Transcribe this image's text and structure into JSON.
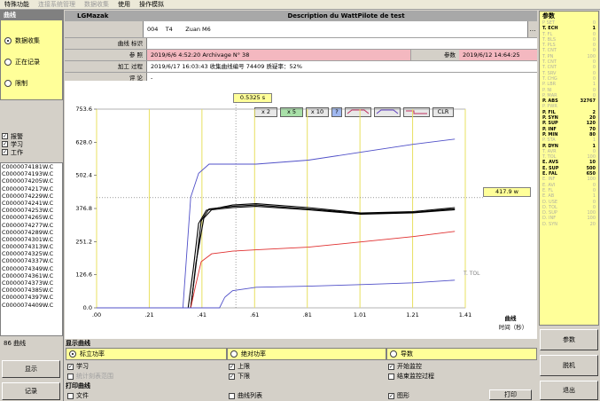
{
  "menu": {
    "items": [
      {
        "label": "特殊功能",
        "dim": false
      },
      {
        "label": "连接系统管理",
        "dim": true
      },
      {
        "label": "数据收集",
        "dim": true
      },
      {
        "label": "使用",
        "dim": false
      },
      {
        "label": "操作模拟",
        "dim": false
      }
    ]
  },
  "left": {
    "header": "曲线",
    "radios": [
      {
        "label": "数据收集",
        "selected": true
      },
      {
        "label": "正在记录",
        "selected": false
      },
      {
        "label": "限制",
        "selected": false
      }
    ],
    "checks": [
      {
        "label": "报警",
        "checked": true
      },
      {
        "label": "学习",
        "checked": true
      },
      {
        "label": "工作",
        "checked": true
      }
    ],
    "files": [
      "C0000074181W.C",
      "C0000074193W.C",
      "C0000074205W.C",
      "C0000074217W.C",
      "C0000074229W.C",
      "C0000074241W.C",
      "C0000074253W.C",
      "C0000074265W.C",
      "C0000074277W.C",
      "C0000074289W.C",
      "C0000074301W.C",
      "C0000074313W.C",
      "C0000074325W.C",
      "C0000074337W.C",
      "C0000074349W.C",
      "C0000074361W.C",
      "C0000074373W.C",
      "C0000074385W.C",
      "C0000074397W.C",
      "C0000074409W.C"
    ],
    "count_label": "86 曲线",
    "btn_display": "显示",
    "btn_record": "记录"
  },
  "header": {
    "app_name": "LGMazak",
    "title": "Description du WattPilote de test",
    "line1_a": "004",
    "line1_b": "T4",
    "line1_c": "Zuan M6",
    "row_curve_label": "曲线 标识",
    "row_ref_label": "参 照",
    "row_ref_value": "2019/6/6 4:52:20 Archivage N° 38",
    "row_param_label": "参数",
    "row_param_value": "2019/6/12 14:64:25",
    "row_proc_label": "加工 过程",
    "row_proc_value": "2019/6/17 16:03:43 收集曲线编号 74409 质疑率：52%",
    "row_comment_label": "评 论",
    "row_comment_value": "-"
  },
  "toolbar": {
    "cursor_readout": "0.5325 s",
    "zoom_labels": [
      "x 2",
      "x 5",
      "x 10"
    ],
    "help": "?",
    "clr": "CLR",
    "right_readout": "417.9 w"
  },
  "chart_data": {
    "type": "line",
    "xlabel": "时间（秒）",
    "ylabel": "",
    "x_unit_label": "曲线",
    "xlim": [
      0.0,
      1.41
    ],
    "ylim": [
      0.0,
      753.6
    ],
    "x_ticks": [
      ".00",
      ".21",
      ".41",
      ".61",
      ".81",
      "1.01",
      "1.21",
      "1.41"
    ],
    "y_ticks": [
      "0.0",
      "126.6",
      "251.2",
      "376.8",
      "502.4",
      "628.0",
      "753.6"
    ],
    "threshold_label": "T. TOL",
    "threshold_y": 417.9,
    "cursor_x": 0.5325,
    "series": [
      {
        "color": "#5050c8",
        "points": [
          [
            0.0,
            0
          ],
          [
            0.33,
            0
          ],
          [
            0.36,
            420
          ],
          [
            0.39,
            510
          ],
          [
            0.43,
            545
          ],
          [
            0.52,
            545
          ],
          [
            0.61,
            545
          ],
          [
            0.81,
            560
          ],
          [
            1.01,
            590
          ],
          [
            1.21,
            620
          ],
          [
            1.37,
            640
          ]
        ]
      },
      {
        "color": "#000000",
        "points": [
          [
            0.0,
            0
          ],
          [
            0.35,
            0
          ],
          [
            0.37,
            150
          ],
          [
            0.39,
            320
          ],
          [
            0.42,
            370
          ],
          [
            0.52,
            390
          ],
          [
            0.61,
            395
          ],
          [
            0.81,
            380
          ],
          [
            1.01,
            360
          ],
          [
            1.21,
            365
          ],
          [
            1.37,
            380
          ]
        ]
      },
      {
        "color": "#000000",
        "points": [
          [
            0.0,
            0
          ],
          [
            0.36,
            0
          ],
          [
            0.38,
            160
          ],
          [
            0.4,
            330
          ],
          [
            0.43,
            375
          ],
          [
            0.52,
            385
          ],
          [
            0.61,
            390
          ],
          [
            0.81,
            375
          ],
          [
            1.01,
            358
          ],
          [
            1.21,
            362
          ],
          [
            1.37,
            375
          ]
        ]
      },
      {
        "color": "#000000",
        "points": [
          [
            0.0,
            0
          ],
          [
            0.36,
            0
          ],
          [
            0.38,
            170
          ],
          [
            0.41,
            340
          ],
          [
            0.44,
            372
          ],
          [
            0.52,
            380
          ],
          [
            0.61,
            385
          ],
          [
            0.81,
            372
          ],
          [
            1.01,
            355
          ],
          [
            1.21,
            360
          ],
          [
            1.37,
            372
          ]
        ]
      },
      {
        "color": "#e03030",
        "points": [
          [
            0.0,
            0
          ],
          [
            0.36,
            0
          ],
          [
            0.38,
            90
          ],
          [
            0.4,
            175
          ],
          [
            0.44,
            205
          ],
          [
            0.52,
            215
          ],
          [
            0.61,
            220
          ],
          [
            0.81,
            230
          ],
          [
            1.01,
            250
          ],
          [
            1.21,
            270
          ],
          [
            1.37,
            290
          ]
        ]
      },
      {
        "color": "#5050c8",
        "points": [
          [
            0.0,
            0
          ],
          [
            0.47,
            0
          ],
          [
            0.49,
            40
          ],
          [
            0.52,
            65
          ],
          [
            0.61,
            78
          ],
          [
            0.81,
            82
          ],
          [
            1.01,
            88
          ],
          [
            1.21,
            95
          ],
          [
            1.37,
            105
          ]
        ]
      }
    ]
  },
  "bottom": {
    "section1_title": "显示曲线",
    "opt1": "标立功率",
    "opt2": "绝对功率",
    "opt3": "导数",
    "checks": [
      {
        "label": "学习",
        "checked": true,
        "dim": false
      },
      {
        "label": "上限",
        "checked": true,
        "dim": false
      },
      {
        "label": "开始监控",
        "checked": true,
        "dim": false
      },
      {
        "label": "统计刻表范围",
        "checked": false,
        "dim": true
      },
      {
        "label": "下限",
        "checked": true,
        "dim": false
      },
      {
        "label": "结束监控过程",
        "checked": false,
        "dim": false
      }
    ],
    "section2_title": "打印曲线",
    "print_checks": [
      {
        "label": "文件",
        "checked": false
      },
      {
        "label": "曲线列表",
        "checked": false
      },
      {
        "label": "图形",
        "checked": true
      }
    ],
    "print_button": "打印"
  },
  "right": {
    "header": "参数",
    "params": [
      {
        "k": "P SET",
        "v": "0",
        "hl": false
      },
      {
        "k": "T. ECH",
        "v": "1",
        "hl": true
      },
      {
        "k": "T. FL",
        "v": "0",
        "hl": false
      },
      {
        "k": "T. BLS",
        "v": "0",
        "hl": false
      },
      {
        "k": "T. PLS",
        "v": "0",
        "hl": false
      },
      {
        "k": "T. CNT",
        "v": "0",
        "hl": false
      },
      {
        "k": "T. PN",
        "v": "100",
        "hl": false
      },
      {
        "k": "T. CNT",
        "v": "0",
        "hl": false
      },
      {
        "k": "T. CNT",
        "v": "0",
        "hl": false
      },
      {
        "k": "T. SRV",
        "v": "0",
        "hl": false
      },
      {
        "k": "T. CHG",
        "v": "0",
        "hl": false
      },
      {
        "k": "P. LBR",
        "v": "1",
        "hl": false
      },
      {
        "k": "P. NI",
        "v": "0",
        "hl": false
      },
      {
        "k": "P. MAR",
        "v": "0",
        "hl": false
      },
      {
        "k": "P. ABS",
        "v": "32767",
        "hl": true
      },
      {
        "k": "P. PWR",
        "v": "",
        "hl": false
      },
      {
        "k": "P. FIL",
        "v": "2",
        "hl": true
      },
      {
        "k": "P. SYN",
        "v": "20",
        "hl": true
      },
      {
        "k": "P. SUP",
        "v": "120",
        "hl": true
      },
      {
        "k": "P. INF",
        "v": "70",
        "hl": true
      },
      {
        "k": "P. MIN",
        "v": "80",
        "hl": true
      },
      {
        "k": "P. STA",
        "v": "1",
        "hl": false
      },
      {
        "k": "P. DYN",
        "v": "1",
        "hl": true
      },
      {
        "k": "T. AVR",
        "v": "0",
        "hl": false
      },
      {
        "k": "T. TOL",
        "v": "100",
        "hl": false
      },
      {
        "k": "E. AVS",
        "v": "10",
        "hl": true
      },
      {
        "k": "E. SUP",
        "v": "500",
        "hl": true
      },
      {
        "k": "E. FAL",
        "v": "650",
        "hl": true
      },
      {
        "k": "E. INF",
        "v": "100",
        "hl": false
      },
      {
        "k": "E. AVI",
        "v": "0",
        "hl": false
      },
      {
        "k": "E. FL",
        "v": "0",
        "hl": false
      },
      {
        "k": "E. AB",
        "v": "1",
        "hl": false
      },
      {
        "k": "D. USE",
        "v": "0",
        "hl": false
      },
      {
        "k": "D. TOL",
        "v": "0",
        "hl": false
      },
      {
        "k": "D. SUP",
        "v": "100",
        "hl": false
      },
      {
        "k": "D. INF",
        "v": "100",
        "hl": false
      },
      {
        "k": "D. SYN",
        "v": "20",
        "hl": false
      }
    ],
    "btn_param": "参数",
    "btn_learn": "脱机",
    "btn_exit": "退出"
  }
}
